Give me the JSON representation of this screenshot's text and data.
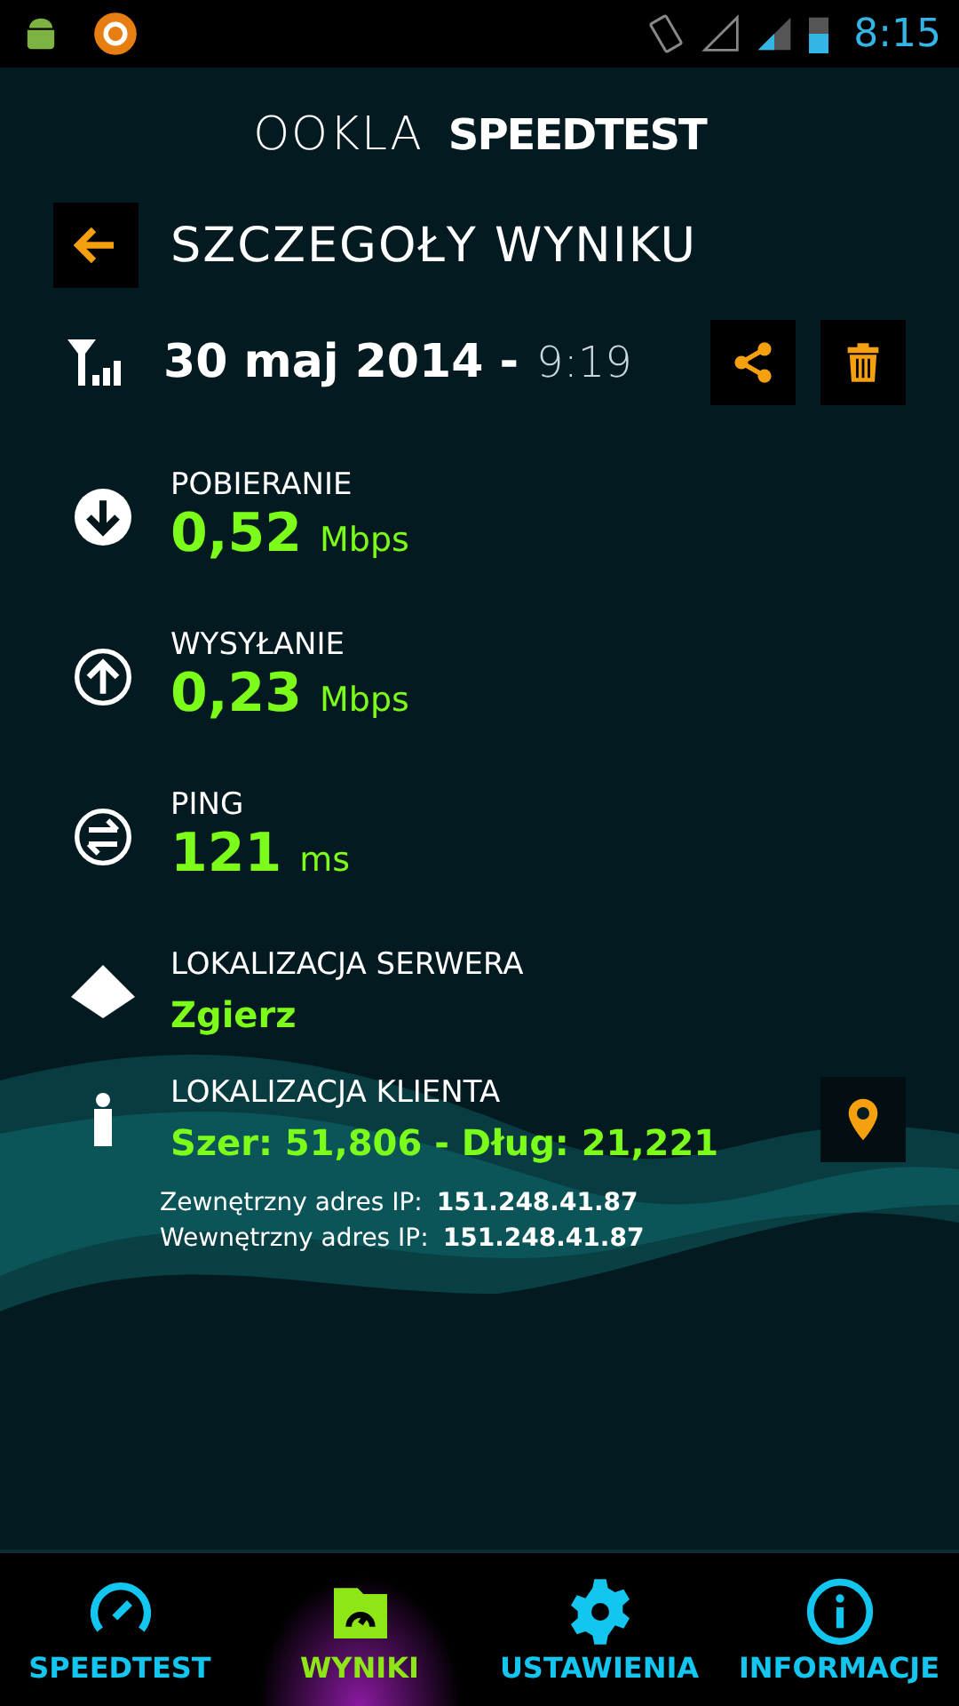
{
  "status_bar": {
    "time": "8:15"
  },
  "header": {
    "logo_left": "OOKLA",
    "logo_right": "SPEEDTEST"
  },
  "title": "SZCZEGOŁY WYNIKU",
  "result": {
    "date": "30 maj 2014 -",
    "time": "9:19"
  },
  "metrics": [
    {
      "kind": "download",
      "label": "POBIERANIE",
      "value": "0,52",
      "unit": "Mbps"
    },
    {
      "kind": "upload",
      "label": "WYSYŁANIE",
      "value": "0,23",
      "unit": "Mbps"
    },
    {
      "kind": "ping",
      "label": "PING",
      "value": "121",
      "unit": "ms"
    }
  ],
  "server": {
    "label": "LOKALIZACJA SERWERA",
    "value": "Zgierz"
  },
  "client": {
    "label": "LOKALIZACJA KLIENTA",
    "value": "Szer: 51,806 - Dług: 21,221",
    "ips": [
      {
        "label": "Zewnętrzny adres IP:",
        "value": "151.248.41.87"
      },
      {
        "label": "Wewnętrzny adres IP:",
        "value": "151.248.41.87"
      }
    ]
  },
  "nav": [
    {
      "kind": "speedtest",
      "label": "SPEEDTEST",
      "selected": false
    },
    {
      "kind": "results",
      "label": "WYNIKI",
      "selected": true
    },
    {
      "kind": "settings",
      "label": "USTAWIENIA",
      "selected": false
    },
    {
      "kind": "info",
      "label": "INFORMACJE",
      "selected": false
    }
  ]
}
